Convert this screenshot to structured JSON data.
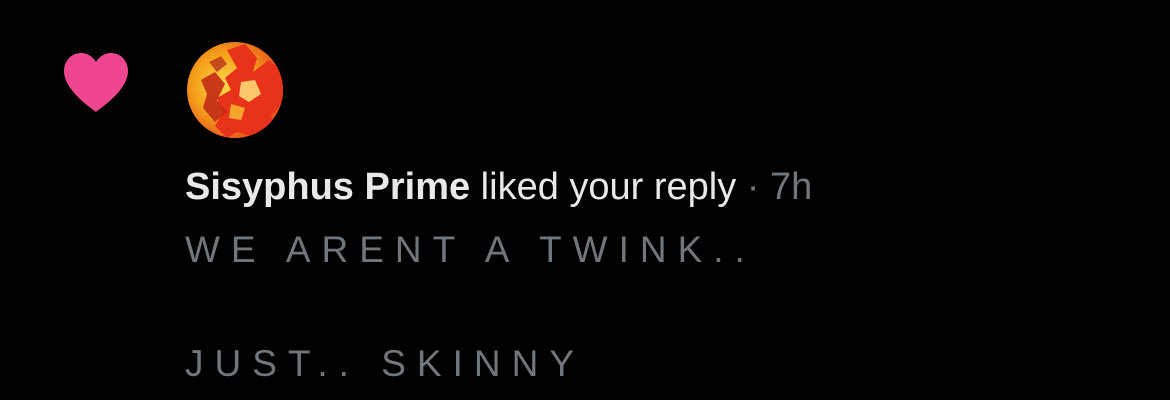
{
  "notification": {
    "type_icon": "heart-icon",
    "avatar_icon": "avatar",
    "user_name": "Sisyphus Prime",
    "action_text": " liked your reply",
    "separator": " · ",
    "timestamp": "7h",
    "reply_lines": [
      "WE ARENT A TWINK..",
      "JUST.. SKINNY"
    ]
  },
  "colors": {
    "background": "#000000",
    "heart": "#f0458f",
    "primary_text": "#e7e9ea",
    "secondary_text": "#71767b"
  }
}
